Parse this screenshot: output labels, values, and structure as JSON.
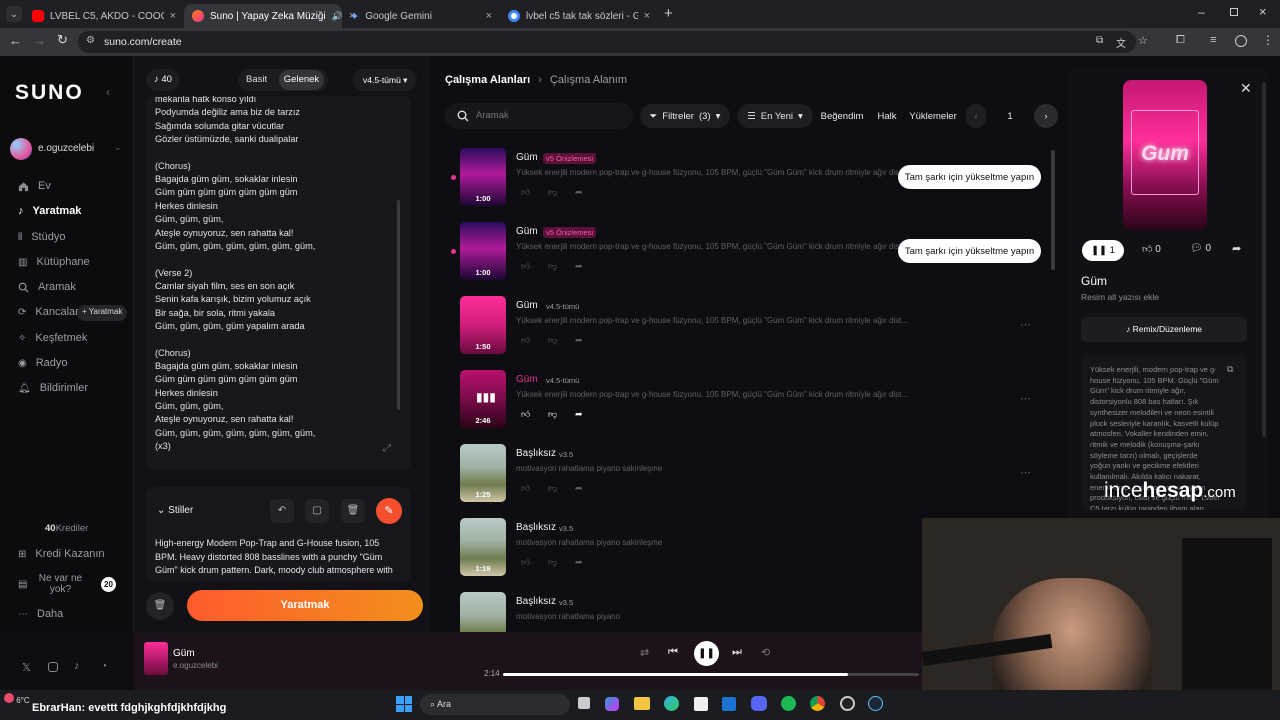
{
  "browser": {
    "tabs": [
      {
        "title": "LVBEL C5, AKDO - COOOK PAR...",
        "active": false
      },
      {
        "title": "Suno | Yapay Zeka Müziği",
        "active": true
      },
      {
        "title": "Google Gemini",
        "active": false
      },
      {
        "title": "lvbel c5 tak tak sözleri - Google ...",
        "active": false
      }
    ],
    "url": "suno.com/create"
  },
  "sidebar": {
    "logo": "SUNO",
    "user": "e.oguzcelebi",
    "items": [
      {
        "label": "Ev",
        "icon": "home-icon"
      },
      {
        "label": "Yaratmak",
        "icon": "music-icon",
        "active": true
      },
      {
        "label": "Stüdyo",
        "icon": "studio-icon"
      },
      {
        "label": "Kütüphane",
        "icon": "library-icon"
      },
      {
        "label": "Aramak",
        "icon": "search-icon"
      },
      {
        "label": "Kancalar",
        "icon": "hook-icon",
        "badge": "+ Yaratmak"
      },
      {
        "label": "Keşfetmek",
        "icon": "compass-icon"
      },
      {
        "label": "Radyo",
        "icon": "radio-icon"
      },
      {
        "label": "Bildirimler",
        "icon": "bell-icon"
      }
    ],
    "credits_value": "40",
    "credits_label": "Krediler",
    "earn": "Kredi Kazanın",
    "whats_new": "Ne var ne yok?",
    "whats_new_count": "20",
    "more": "Daha"
  },
  "create": {
    "credits": "40",
    "modes": [
      "Basit",
      "Gelenek"
    ],
    "active_mode": "Gelenek",
    "model": "v4.5-tümü",
    "lyrics": [
      "mekanla hatk konso yıldı",
      "Podyumda değiliz ama biz de tarzız",
      "Sağımda solumda gitar vücutlar",
      "Gözler üstümüzde, sanki dualipalar",
      "",
      "(Chorus)",
      "Bagajda güm güm, sokaklar inlesin",
      "Güm güm güm güm güm güm güm",
      "Herkes dinlesin",
      "Güm, güm, güm,",
      "Ateşle oynuyoruz, sen rahatta kal!",
      "Güm, güm, güm, güm, güm, güm, güm,",
      "",
      "(Verse 2)",
      "Camlar siyah film, ses en son açık",
      "Senin kafa karışık, bizim yolumuz açık",
      "Bir sağa, bir sola, ritmi yakala",
      "Güm, güm, güm, güm yapalım arada",
      "",
      "(Chorus)",
      "Bagajda güm güm, sokaklar inlesin",
      "Güm güm güm güm güm güm güm",
      "Herkes dinlesin",
      "Güm, güm, güm,",
      "Ateşle oynuyoruz, sen rahatta kal!",
      "Güm, güm, güm, güm, güm, güm, güm,",
      "(x3)"
    ],
    "styles_label": "Stiller",
    "styles_text": [
      "High-energy Modern Pop-Trap and G-House fusion, 105",
      "BPM. Heavy distorted 808 basslines with a punchy \"Güm",
      "Güm\" kick drum pattern. Dark, moody club atmosphere with"
    ],
    "create_button": "Yaratmak"
  },
  "workspace": {
    "breadcrumb_root": "Çalışma Alanları",
    "breadcrumb_current": "Çalışma Alanım",
    "search_placeholder": "Aramak",
    "filters": "Filtreler",
    "filters_count": "(3)",
    "sort": "En Yeni",
    "liked": "Beğendim",
    "public": "Halk",
    "uploads": "Yüklemeler",
    "page": "1",
    "songs": [
      {
        "title": "Güm",
        "tag": "v5 Önizlemesi",
        "desc": "Yüksek enerjili modern pop-trap ve g-house füzyonu, 105 BPM, güçlü \"Güm Güm\" kick drum ritmiyle ağır dist...",
        "duration": "1:00",
        "upgrade": "Tam şarkı için yükseltme yapın",
        "thumb": "neon-club"
      },
      {
        "title": "Güm",
        "tag": "v5 Önizlemesi",
        "desc": "Yüksek enerjili modern pop-trap ve g-house füzyonu, 105 BPM, güçlü \"Güm Güm\" kick drum ritmiyle ağır dist...",
        "duration": "1:00",
        "upgrade": "Tam şarkı için yükseltme yapın",
        "thumb": "neon-club"
      },
      {
        "title": "Güm",
        "tag": "v4.5-tümü",
        "desc": "Yüksek enerjili modern pop-trap ve g-house füzyonu, 105 BPM, güçlü \"Güm Güm\" kick drum ritmiyle ağır dist...",
        "duration": "1:50",
        "upgrade": "",
        "thumb": "pink"
      },
      {
        "title": "Güm",
        "tag": "v4.5-tümü",
        "desc": "Yüksek enerjili modern pop-trap ve g-house füzyonu, 105 BPM, güçlü \"Güm Güm\" kick drum ritmiyle ağır dist...",
        "duration": "2:46",
        "upgrade": "",
        "thumb": "pink-dark",
        "playing": true
      },
      {
        "title": "Başlıksız",
        "tag": "v3.5",
        "desc": "motivasyon rahatlama piyano sakinleşme",
        "duration": "1:25",
        "upgrade": "",
        "thumb": "landscape"
      },
      {
        "title": "Başlıksız",
        "tag": "v3.5",
        "desc": "motivasyon rahatlama piyano sakinleşme",
        "duration": "1:19",
        "upgrade": "",
        "thumb": "landscape"
      },
      {
        "title": "Başlıksız",
        "tag": "v3.5",
        "desc": "motivasyon rahatlama piyano",
        "duration": "",
        "upgrade": "",
        "thumb": "landscape"
      }
    ]
  },
  "detail": {
    "cover_text": "Gum",
    "plays": "1",
    "likes": "0",
    "comments": "0",
    "title": "Güm",
    "subtitle": "Resim alt yazısı ekle",
    "remix": "Remix/Düzenleme",
    "description": "Yüksek enerjili, modern pop-trap ve g-house füzyonu, 105 BPM. Güçlü \"Güm Güm\" kick drum ritmiyle ağır, distorsiyonlu 808 bas hatları. Şık synthesizer melodileri ve neon esintili pluck sesleriyle karanlık, kasvetli kulüp atmosferi. Vokaller kendinden emin, ritmik ve melodik (konuşma-şarkı söyleme tarzı) olmalı, geçişlerde yoğun yankı ve gecikme efektleri kullanılmalı. Akılda kalıcı nakarat, enerjik drop, kulüp ortamına uygun prodüksiyon, cilalı ve güçlü miks. Lvbel C5 tarzı kulüp rapinden ilham alan ritmik akış."
  },
  "player": {
    "title": "Güm",
    "artist": "e.oguzcelebi",
    "elapsed": "2:14",
    "progress": 0.83
  },
  "overlay": {
    "watermark_a": "ince",
    "watermark_b": "hesap",
    "watermark_c": ".com",
    "chat_user": "EbrarHan",
    "chat_message": ": evettt fdghjkghfdjkhfdjkhg"
  },
  "taskbar": {
    "temperature": "6°C",
    "search": "Ara"
  },
  "colors": {
    "accent": "#ff4d2e",
    "pink": "#e6348f",
    "create_gradient": [
      "#ff5b2c",
      "#f2901c"
    ]
  }
}
